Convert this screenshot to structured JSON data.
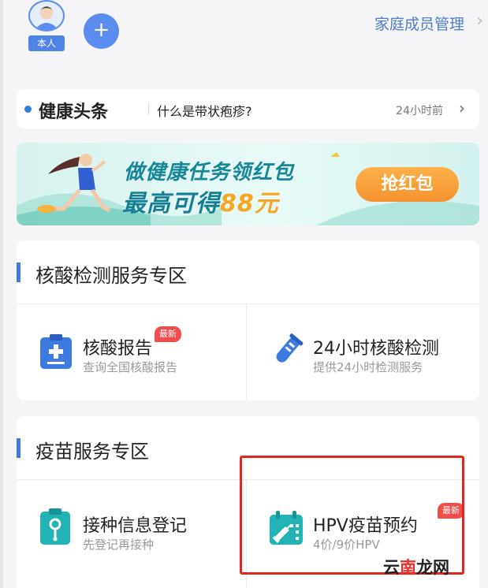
{
  "header": {
    "me_label": "本人",
    "add_label": "+",
    "family_link": "家庭成员管理"
  },
  "headline": {
    "title": "健康头条",
    "text": "什么是带状疱疹?",
    "time": "24小时前"
  },
  "banner": {
    "line1": "做健康任务领红包",
    "line2_prefix": "最高可得",
    "line2_amount": "88元",
    "button": "抢红包"
  },
  "sections": [
    {
      "title": "核酸检测服务专区",
      "items": [
        {
          "title": "核酸报告",
          "subtitle": "查询全国核酸报告",
          "badge": "最新",
          "icon": "clipboard-plus-icon"
        },
        {
          "title": "24小时核酸检测",
          "subtitle": "提供24小时检测服务",
          "icon": "test-tube-icon"
        }
      ]
    },
    {
      "title": "疫苗服务专区",
      "items": [
        {
          "title": "接种信息登记",
          "subtitle": "先登记再接种",
          "icon": "register-clipboard-icon"
        },
        {
          "title": "HPV疫苗预约",
          "subtitle": "4价/9价HPV",
          "badge": "最新",
          "icon": "calendar-syringe-icon"
        }
      ]
    }
  ],
  "watermark": {
    "part1": "云",
    "part2": "南",
    "part3": "龙网"
  },
  "colors": {
    "accent": "#3e7be0",
    "badge": "#f04d4d",
    "banner_button": "#f2932e",
    "highlight": "#e0281e"
  }
}
